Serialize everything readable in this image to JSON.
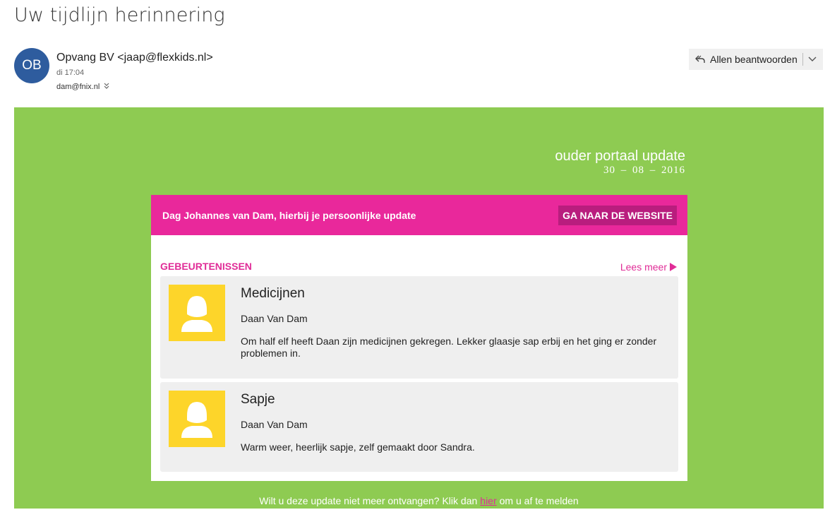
{
  "email": {
    "subject": "Uw tijdlijn herinnering",
    "sender_initials": "OB",
    "sender": "Opvang BV <jaap@flexkids.nl>",
    "sent_time": "di 17:04",
    "recipients": "dam@fnix.nl",
    "reply_all_label": "Allen beantwoorden"
  },
  "newsletter": {
    "portal_title": "ouder portaal update",
    "portal_date": "30 – 08 – 2016",
    "greeting": "Dag Johannes van Dam, hierbij je persoonlijke update",
    "website_button": "GA NAAR DE WEBSITE",
    "section_title": "GEBEURTENISSEN",
    "read_more": "Lees meer",
    "events": [
      {
        "title": "Medicijnen",
        "child": "Daan Van Dam",
        "description": "Om half elf heeft Daan zijn medicijnen gekregen. Lekker glaasje sap erbij en het ging er zonder problemen in."
      },
      {
        "title": "Sapje",
        "child": "Daan Van Dam",
        "description": "Warm weer, heerlijk sapje, zelf gemaakt door Sandra."
      }
    ],
    "footer": {
      "before": "Wilt u deze update niet meer ontvangen? Klik dan",
      "link": "hier",
      "after": "om u af te melden"
    }
  },
  "colors": {
    "banner_green": "#8ecb52",
    "brand_pink": "#e9289b",
    "thumb_yellow": "#fdd52a",
    "avatar_blue": "#2e5c9e"
  },
  "icons": [
    "reply-all-icon",
    "chevron-down-icon",
    "expand-recipients-icon",
    "play-arrow-icon",
    "person-placeholder-icon"
  ]
}
